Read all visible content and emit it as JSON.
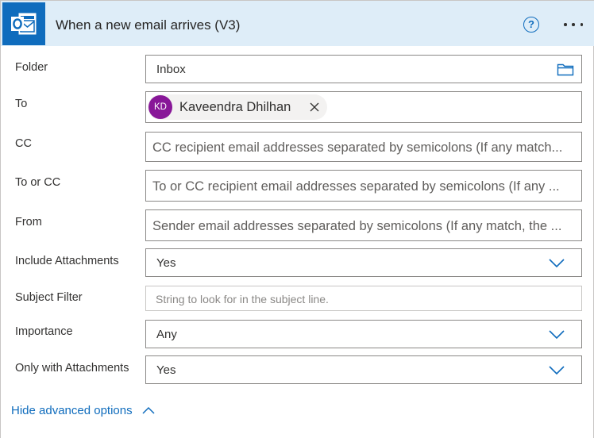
{
  "header": {
    "title": "When a new email arrives (V3)",
    "help_glyph": "?",
    "app_icon": "outlook-icon",
    "accent": "#0f6cbd",
    "background": "#deedf8"
  },
  "fields": {
    "folder": {
      "label": "Folder",
      "value": "Inbox",
      "icon": "folder-icon"
    },
    "to": {
      "label": "To",
      "recipient": {
        "initials": "KD",
        "name": "Kaveendra Dhilhan",
        "avatar_color": "#881798"
      }
    },
    "cc": {
      "label": "CC",
      "placeholder": "CC recipient email addresses separated by semicolons (If any match..."
    },
    "to_or_cc": {
      "label": "To or CC",
      "placeholder": "To or CC recipient email addresses separated by semicolons (If any ..."
    },
    "from": {
      "label": "From",
      "placeholder": "Sender email addresses separated by semicolons (If any match, the ..."
    },
    "include_attachments": {
      "label": "Include Attachments",
      "value": "Yes"
    },
    "subject_filter": {
      "label": "Subject Filter",
      "placeholder": "String to look for in the subject line."
    },
    "importance": {
      "label": "Importance",
      "value": "Any"
    },
    "only_with_attachments": {
      "label": "Only with Attachments",
      "value": "Yes"
    }
  },
  "footer": {
    "advanced_link": "Hide advanced options"
  }
}
